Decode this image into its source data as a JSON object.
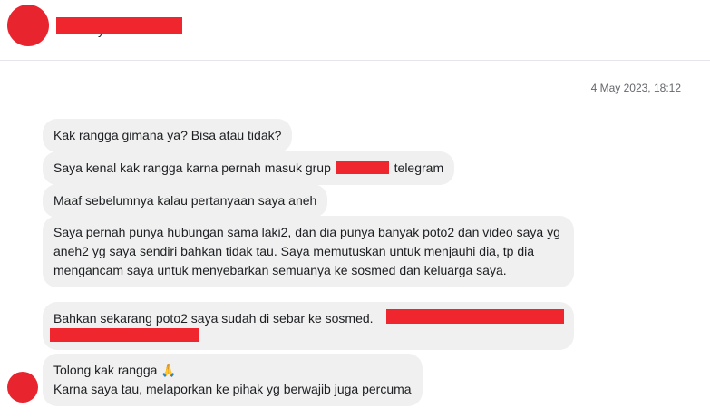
{
  "header": {
    "contact_name": "y2"
  },
  "thread": {
    "timestamp": "4 May 2023, 18:12"
  },
  "messages": [
    {
      "text": "Kak rangga gimana ya? Bisa atau tidak?"
    },
    {
      "text_before": "Saya kenal kak rangga karna pernah masuk grup",
      "text_after": "telegram"
    },
    {
      "text": "Maaf sebelumnya kalau pertanyaan saya aneh"
    },
    {
      "text": "Saya pernah punya hubungan sama laki2, dan dia punya banyak poto2 dan video saya yg aneh2 yg saya sendiri bahkan tidak tau. Saya memutuskan untuk menjauhi dia, tp dia mengancam saya untuk menyebarkan semuanya ke sosmed dan keluarga saya."
    },
    {
      "text": "Bahkan sekarang poto2 saya sudah di sebar ke sosmed."
    },
    {
      "line1": "Tolong kak rangga 🙏",
      "line2": "Karna saya tau, melaporkan ke pihak yg berwajib juga percuma"
    }
  ],
  "colors": {
    "redaction": "#f0262e",
    "bubble": "#f0f0f0"
  }
}
